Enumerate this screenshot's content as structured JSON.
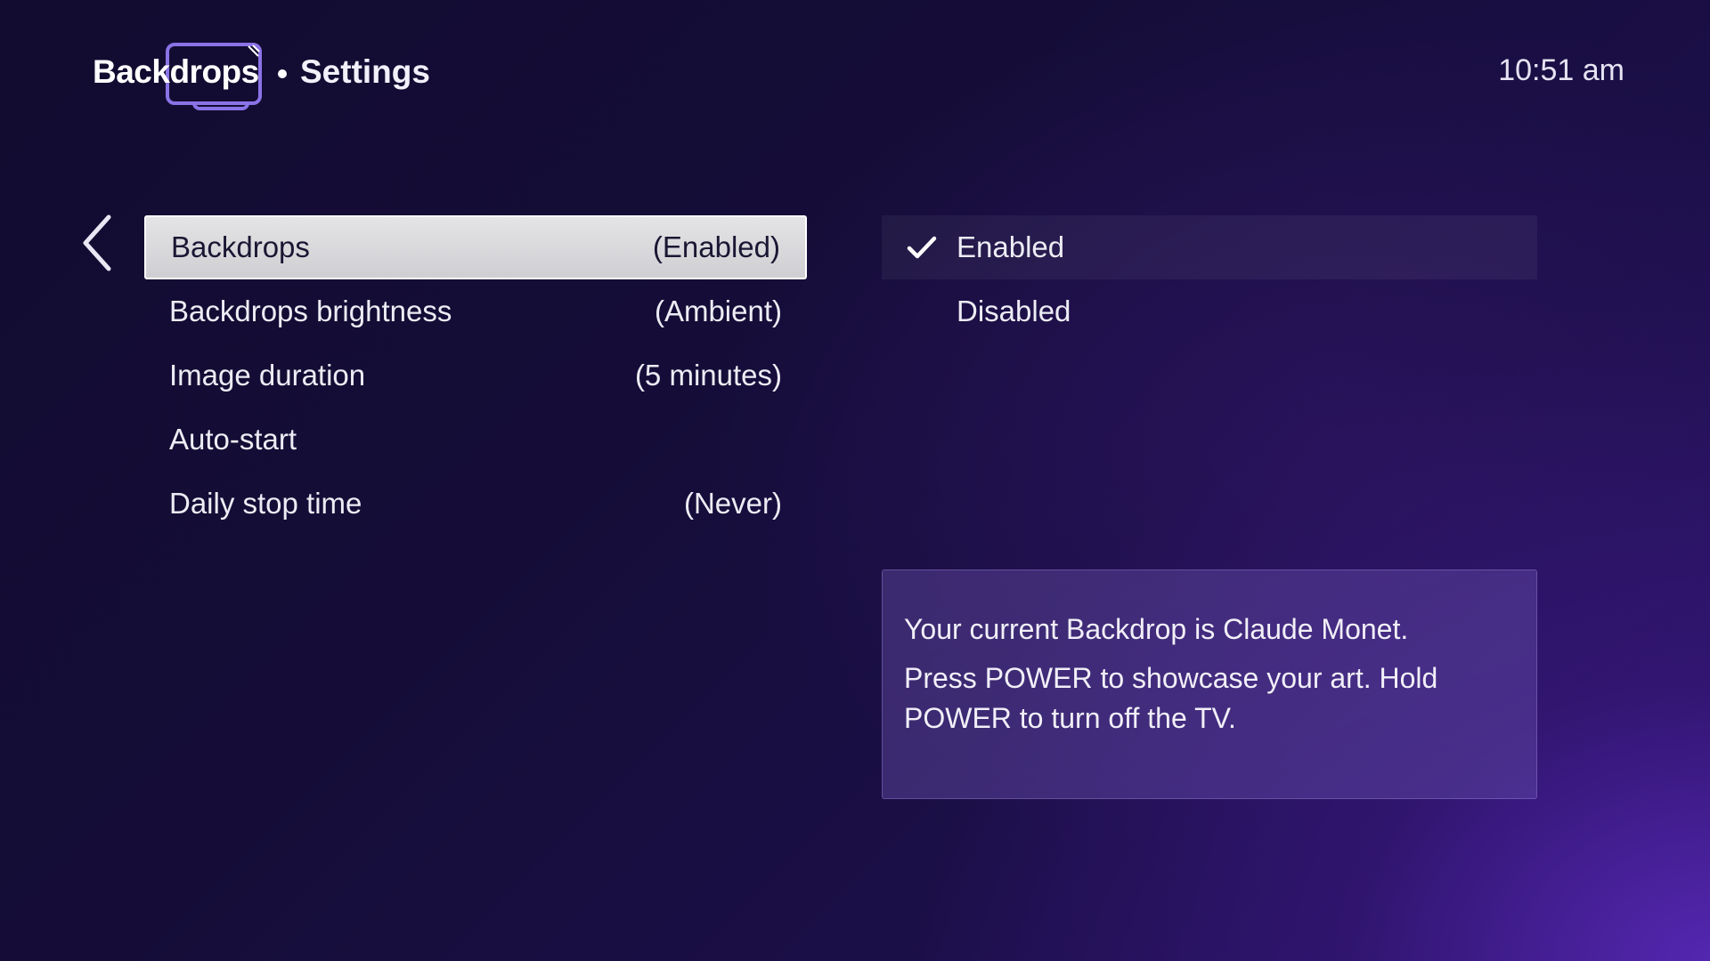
{
  "header": {
    "logo_text": "Backdrops",
    "title": "Settings",
    "time": "10:51 am"
  },
  "menu": {
    "items": [
      {
        "label": "Backdrops",
        "value": "(Enabled)",
        "selected": true
      },
      {
        "label": "Backdrops brightness",
        "value": "(Ambient)"
      },
      {
        "label": "Image duration",
        "value": "(5 minutes)"
      },
      {
        "label": "Auto-start",
        "value": ""
      },
      {
        "label": "Daily stop time",
        "value": "(Never)"
      }
    ]
  },
  "options": {
    "items": [
      {
        "label": "Enabled",
        "checked": true
      },
      {
        "label": "Disabled",
        "checked": false
      }
    ]
  },
  "info": {
    "line1": "Your current Backdrop is Claude Monet.",
    "line2": "Press POWER to showcase your art. Hold POWER to turn off the TV."
  },
  "colors": {
    "accent": "#8a73e6",
    "selected_bg": "#dcdcdf",
    "background_dark": "#140d34",
    "background_glow": "#4a1fa8"
  },
  "icons": {
    "back": "chevron-left-icon",
    "check": "checkmark-icon",
    "logo": "tv-frame-icon"
  }
}
